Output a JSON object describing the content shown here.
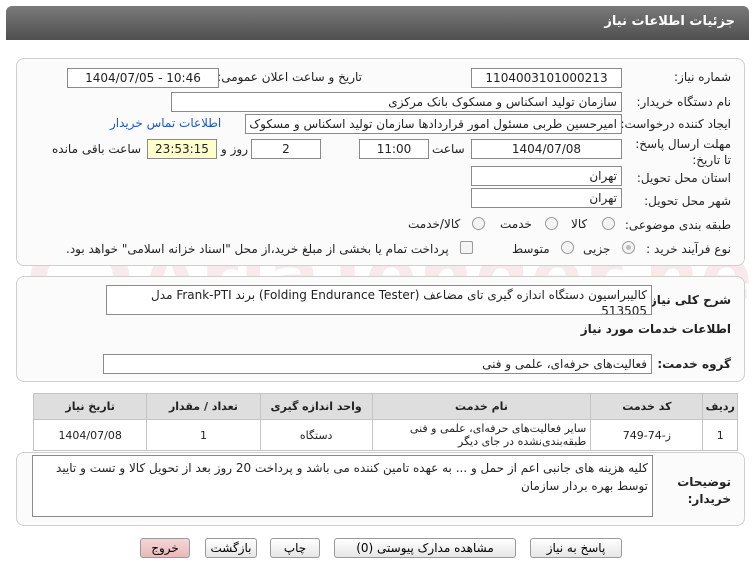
{
  "title": "جزئیات اطلاعات نیاز",
  "fields": {
    "need_number_label": "شماره نیاز:",
    "need_number": "1104003101000213",
    "announce_label": "تاریخ و ساعت اعلان عمومی:",
    "announce_value": "1404/07/05 - 10:46",
    "buyer_org_label": "نام دستگاه خریدار:",
    "buyer_org": "سازمان تولید اسکناس و مسکوک بانک مرکزی",
    "creator_label": "ایجاد کننده درخواست:",
    "creator": "امیرحسین طربی مسئول امور قراردادها سازمان تولید اسکناس و مسکوک بانک مرکزی",
    "contact_link": "اطلاعات تماس خریدار",
    "deadline_label": "مهلت ارسال پاسخ: تا تاریخ:",
    "deadline_date": "1404/07/08",
    "time_label": "ساعت",
    "deadline_time": "11:00",
    "days": "2",
    "days_label": "روز و",
    "remaining": "23:53:15",
    "remaining_label": "ساعت باقی مانده",
    "province_label": "استان محل تحویل:",
    "province": "تهران",
    "city_label": "شهر محل تحویل:",
    "city": "تهران",
    "category_label": "طبقه بندی موضوعی:",
    "category_options": [
      "کالا",
      "خدمت",
      "کالا/خدمت"
    ],
    "process_label": "نوع فرآیند خرید :",
    "process_options": [
      "جزیی",
      "متوسط"
    ],
    "payment_note": "پرداخت تمام یا بخشی از مبلغ خرید،از محل \"اسناد خزانه اسلامی\" خواهد بود."
  },
  "summary": {
    "label": "شرح کلی نیاز:",
    "text": "کالیبراسیون دستگاه اندازه گیری تای مضاعف (Folding Endurance Tester) برند Frank-PTI مدل 513505"
  },
  "services": {
    "heading": "اطلاعات خدمات مورد نیاز",
    "group_label": "گروه خدمت:",
    "group_value": "فعالیت‌های حرفه‌ای، علمی و فنی"
  },
  "table": {
    "headers": [
      "ردیف",
      "کد خدمت",
      "نام خدمت",
      "واحد اندازه گیری",
      "تعداد / مقدار",
      "تاریخ نیاز"
    ],
    "rows": [
      [
        "1",
        "ز-74-749",
        "سایر فعالیت‌های حرفه‌ای، علمی و فنی طبقه‌بندی‌نشده در جای دیگر",
        "دستگاه",
        "1",
        "1404/07/08"
      ]
    ]
  },
  "notes": {
    "label": "توضیحات خریدار:",
    "text": "کلیه هزینه های جانبی اعم از حمل و ... به عهده تامین کننده می باشد و پرداخت 20 روز بعد از تحویل کالا و تست و تایید توسط بهره بردار سازمان"
  },
  "buttons": {
    "respond": "پاسخ به نیاز",
    "attachments": "مشاهده مدارک پیوستی (0)",
    "print": "چاپ",
    "back": "بازگشت",
    "exit": "خروج"
  },
  "watermark": "AriaTender.net"
}
